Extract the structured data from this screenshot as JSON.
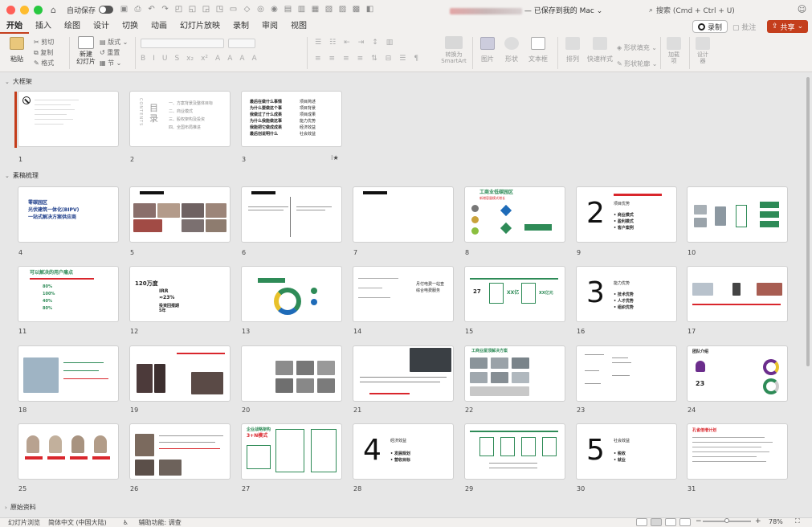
{
  "titlebar": {
    "autosave_label": "自动保存",
    "doc_title_suffix": "— 已保存到我的 Mac",
    "search_placeholder": "搜索 (Cmd + Ctrl + U)"
  },
  "tabs": [
    "开始",
    "插入",
    "绘图",
    "设计",
    "切换",
    "动画",
    "幻灯片放映",
    "录制",
    "审阅",
    "视图"
  ],
  "actions": {
    "record": "录制",
    "comment": "批注",
    "share": "共享"
  },
  "ribbon": {
    "paste": "粘贴",
    "cut": "剪切",
    "copy": "复制",
    "format": "格式",
    "new_slide": "新建\n幻灯片",
    "layout": "版式",
    "reset": "重置",
    "section": "节",
    "smartart": "转换为\nSmartArt",
    "picture": "图片",
    "shape": "形状",
    "textbox": "文本框",
    "arrange": "排列",
    "quick_style": "快速样式",
    "shape_fill": "形状填充",
    "shape_outline": "形状轮廓",
    "addins": "加载\n项",
    "designer": "设计\n器"
  },
  "sections": [
    {
      "name": "大框架",
      "expanded": true
    },
    {
      "name": "素稿梳理",
      "expanded": true
    },
    {
      "name": "原始资料",
      "expanded": false
    }
  ],
  "slides": {
    "s1": {
      "num": "1"
    },
    "s2": {
      "num": "2",
      "title_cn": "目录",
      "title_en": "CONTENTS",
      "items": [
        "一、方案背景及整体目标",
        "二、商业模式",
        "三、股权架构及投资",
        "四、全国布局推进"
      ]
    },
    "s3": {
      "num": "3",
      "left": [
        "最后在做什么事情",
        "为什么要做这个事",
        "我做过了什么成果",
        "为什么我能做这事",
        "我能把它做成成果",
        "最后创说明什么"
      ],
      "right": [
        "项目简述",
        "项目背景",
        "项目成果",
        "能力优势",
        "经济效益",
        "社会效益"
      ]
    },
    "s4": {
      "num": "4",
      "lines": [
        "零碳园区",
        "光伏建筑一体化(BIPV)",
        "一站式解决方案供应商"
      ]
    },
    "s5": {
      "num": "5"
    },
    "s6": {
      "num": "6"
    },
    "s7": {
      "num": "7"
    },
    "s8": {
      "num": "8",
      "title": "工商业低碳园区",
      "subtitle": "新增容量模式增长"
    },
    "s9": {
      "num": "9",
      "big": "2",
      "heading": "项目优势",
      "items": [
        "• 商业模式",
        "• 盈利模式",
        "• 客户案例"
      ]
    },
    "s10": {
      "num": "10"
    },
    "s11": {
      "num": "11",
      "title": "可以解决的用户痛点",
      "rows": [
        "80%",
        "100%",
        "40%",
        "80%"
      ]
    },
    "s12": {
      "num": "12",
      "v1": "120万度",
      "irr": "IRR",
      "irr_val": "≈23%",
      "payback": "投资回报期\n5年"
    },
    "s13": {
      "num": "13"
    },
    "s14": {
      "num": "14",
      "text": "月付电费一站查\n综合电费服务"
    },
    "s15": {
      "num": "15",
      "a": "27",
      "b": "XX亿",
      "c": "XX亿元"
    },
    "s16": {
      "num": "16",
      "big": "3",
      "heading": "能力优势",
      "items": [
        "• 技术优势",
        "• 人才优势",
        "• 组织优势"
      ]
    },
    "s17": {
      "num": "17"
    },
    "s18": {
      "num": "18"
    },
    "s19": {
      "num": "19"
    },
    "s20": {
      "num": "20"
    },
    "s21": {
      "num": "21"
    },
    "s22": {
      "num": "22",
      "title": "工商业屋顶解决方案"
    },
    "s23": {
      "num": "23"
    },
    "s24": {
      "num": "24",
      "title": "团队介绍",
      "stat": "23"
    },
    "s25": {
      "num": "25"
    },
    "s26": {
      "num": "26"
    },
    "s27": {
      "num": "27",
      "title": "企业战略架构",
      "sub": "3+N模式"
    },
    "s28": {
      "num": "28",
      "big": "4",
      "heading": "经济效益",
      "items": [
        "• 发展规划",
        "• 营收目标"
      ]
    },
    "s29": {
      "num": "29"
    },
    "s30": {
      "num": "30",
      "big": "5",
      "heading": "社会效益",
      "items": [
        "• 税收",
        "• 就业"
      ]
    },
    "s31": {
      "num": "31",
      "title": "孔雀倍增计划"
    }
  },
  "status": {
    "left": "幻灯片浏览",
    "lang": "简体中文 (中国大陆)",
    "access": "辅助功能: 调查",
    "zoom": "78%"
  },
  "colors": {
    "accent": "#c43e1c",
    "green": "#2e8b57",
    "red": "#d9262c"
  }
}
